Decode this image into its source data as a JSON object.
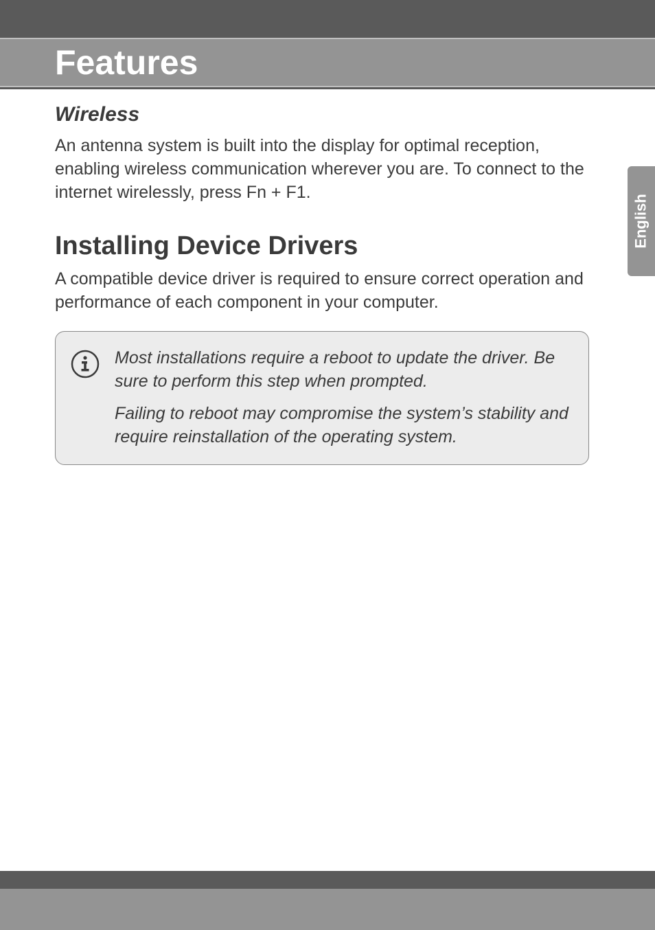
{
  "header": {
    "title": "Features"
  },
  "sidebar": {
    "language": "English"
  },
  "wireless": {
    "heading": "Wireless",
    "body": "An antenna system is built into the display for optimal reception, enabling wireless communication wherever you are. To connect to the internet wirelessly, press Fn + F1."
  },
  "drivers": {
    "heading": "Installing Device Drivers",
    "body": "A compatible device driver is required to ensure correct operation and performance of each component in your computer."
  },
  "note": {
    "icon_name": "info-icon",
    "p1": "Most installations require a reboot to update the driver. Be sure to perform this step when prompted.",
    "p2": "Failing to reboot may compromise the system’s stability and require reinstallation of the operating system."
  }
}
